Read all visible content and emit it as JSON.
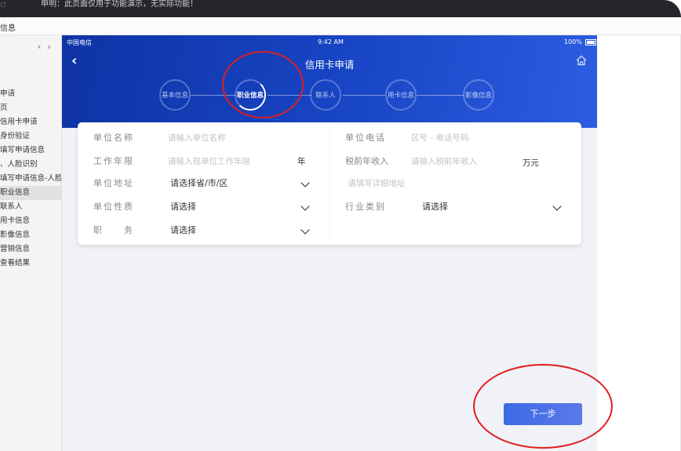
{
  "topbar": {
    "icon": "window-icon",
    "notice": "申明：此页面仅用于功能演示，无实际功能！"
  },
  "subbar": {
    "label": "信息"
  },
  "sidebar": {
    "nav_prev": "‹",
    "nav_next": "›",
    "items": [
      {
        "label": "申请"
      },
      {
        "label": "页"
      },
      {
        "label": "信用卡申请"
      },
      {
        "label": "身份验证"
      },
      {
        "label": "填写申请信息"
      },
      {
        "label": "、人脸识别"
      },
      {
        "label": "填写申请信息-人脸识"
      },
      {
        "label": "职业信息",
        "active": true
      },
      {
        "label": "联系人"
      },
      {
        "label": "用卡信息"
      },
      {
        "label": "影像信息"
      },
      {
        "label": "营销信息"
      },
      {
        "label": "查看结果"
      }
    ]
  },
  "status": {
    "carrier": "中国电信",
    "time": "9:42 AM",
    "battery": "100%"
  },
  "header": {
    "title": "信用卡申请",
    "back_icon": "chevron-left-icon",
    "home_icon": "home-icon"
  },
  "steps": [
    {
      "label": "基本信息"
    },
    {
      "label": "职业信息"
    },
    {
      "label": "联系人"
    },
    {
      "label": "用卡信息"
    },
    {
      "label": "影像信息"
    }
  ],
  "form": {
    "company_name": {
      "label": "单位名称",
      "placeholder": "请输入单位名称"
    },
    "company_phone": {
      "label": "单位电话",
      "placeholder": "区号 - 电话号码"
    },
    "work_years": {
      "label": "工作年限",
      "placeholder": "请输入现单位工作年限",
      "unit": "年"
    },
    "income": {
      "label": "税前年收入",
      "placeholder": "请输入税前年收入",
      "unit": "万元"
    },
    "company_address": {
      "label": "单位地址",
      "value": "请选择省/市/区",
      "detail_placeholder": "请填写详细地址"
    },
    "company_type": {
      "label": "单位性质",
      "value": "请选择"
    },
    "industry": {
      "label": "行业类别",
      "value": "请选择"
    },
    "position": {
      "label": "职　　务",
      "value": "请选择"
    }
  },
  "next_button": {
    "label": "下一步"
  },
  "colors": {
    "header_start": "#0f33a5",
    "header_end": "#2d5de0",
    "button": "#4a6ee6",
    "annotation": "#e01e1e"
  }
}
